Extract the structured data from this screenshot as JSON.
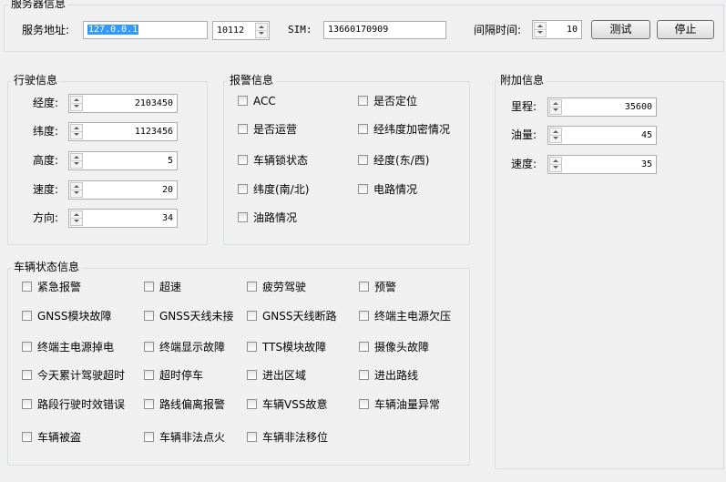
{
  "server": {
    "group_title": "服务器信息",
    "address_label": "服务地址:",
    "address_value": "127.0.0.1",
    "port_value": "10112",
    "sim_label": "SIM:",
    "sim_value": "13660170909",
    "interval_label": "间隔时间:",
    "interval_value": "10",
    "test_label": "测试",
    "stop_label": "停止"
  },
  "driving": {
    "group_title": "行驶信息",
    "fields": [
      {
        "label": "经度:",
        "value": "2103450"
      },
      {
        "label": "纬度:",
        "value": "1123456"
      },
      {
        "label": "高度:",
        "value": "5"
      },
      {
        "label": "速度:",
        "value": "20"
      },
      {
        "label": "方向:",
        "value": "34"
      }
    ]
  },
  "alarm": {
    "group_title": "报警信息",
    "items": [
      {
        "label": "ACC",
        "checked": false
      },
      {
        "label": "是否定位",
        "checked": false
      },
      {
        "label": "是否运营",
        "checked": false
      },
      {
        "label": "经纬度加密情况",
        "checked": false
      },
      {
        "label": "车辆锁状态",
        "checked": false
      },
      {
        "label": "经度(东/西)",
        "checked": false
      },
      {
        "label": "纬度(南/北)",
        "checked": false
      },
      {
        "label": "电路情况",
        "checked": false
      },
      {
        "label": "油路情况",
        "checked": false
      }
    ]
  },
  "extra": {
    "group_title": "附加信息",
    "fields": [
      {
        "label": "里程:",
        "value": "35600"
      },
      {
        "label": "油量:",
        "value": "45"
      },
      {
        "label": "速度:",
        "value": "35"
      }
    ]
  },
  "vehicle_status": {
    "group_title": "车辆状态信息",
    "items": [
      {
        "label": "紧急报警",
        "checked": false
      },
      {
        "label": "超速",
        "checked": false
      },
      {
        "label": "疲劳驾驶",
        "checked": false
      },
      {
        "label": "预警",
        "checked": false
      },
      {
        "label": "GNSS模块故障",
        "checked": false
      },
      {
        "label": "GNSS天线未接",
        "checked": false
      },
      {
        "label": "GNSS天线断路",
        "checked": false
      },
      {
        "label": "终端主电源欠压",
        "checked": false
      },
      {
        "label": "终端主电源掉电",
        "checked": false
      },
      {
        "label": "终端显示故障",
        "checked": false
      },
      {
        "label": "TTS模块故障",
        "checked": false
      },
      {
        "label": "摄像头故障",
        "checked": false
      },
      {
        "label": "今天累计驾驶超时",
        "checked": false
      },
      {
        "label": "超时停车",
        "checked": false
      },
      {
        "label": "进出区域",
        "checked": false
      },
      {
        "label": "进出路线",
        "checked": false
      },
      {
        "label": "路段行驶时效错误",
        "checked": false
      },
      {
        "label": "路线偏离报警",
        "checked": false
      },
      {
        "label": "车辆VSS故意",
        "checked": false
      },
      {
        "label": "车辆油量异常",
        "checked": false
      },
      {
        "label": "车辆被盗",
        "checked": false
      },
      {
        "label": "车辆非法点火",
        "checked": false
      },
      {
        "label": "车辆非法移位",
        "checked": false
      }
    ]
  }
}
